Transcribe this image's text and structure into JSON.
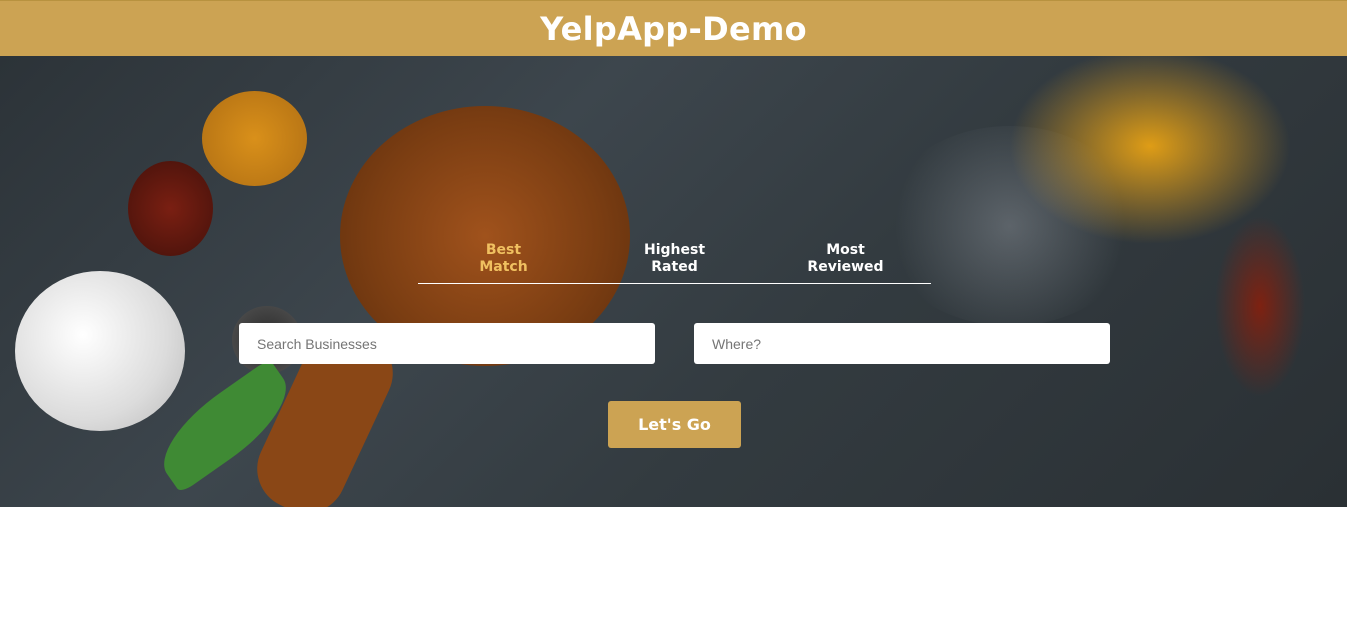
{
  "header": {
    "title": "YelpApp-Demo"
  },
  "sort_tabs": [
    {
      "line1": "Best",
      "line2": "Match",
      "active": true
    },
    {
      "line1": "Highest",
      "line2": "Rated",
      "active": false
    },
    {
      "line1": "Most",
      "line2": "Reviewed",
      "active": false
    }
  ],
  "search": {
    "term_placeholder": "Search Businesses",
    "term_value": "",
    "location_placeholder": "Where?",
    "location_value": ""
  },
  "submit_label": "Let's Go",
  "colors": {
    "brand": "#cca353",
    "active_tab": "#f0c060",
    "hero_background": "#333b40"
  },
  "hero_image": "spices-and-wooden-spoon-photo"
}
